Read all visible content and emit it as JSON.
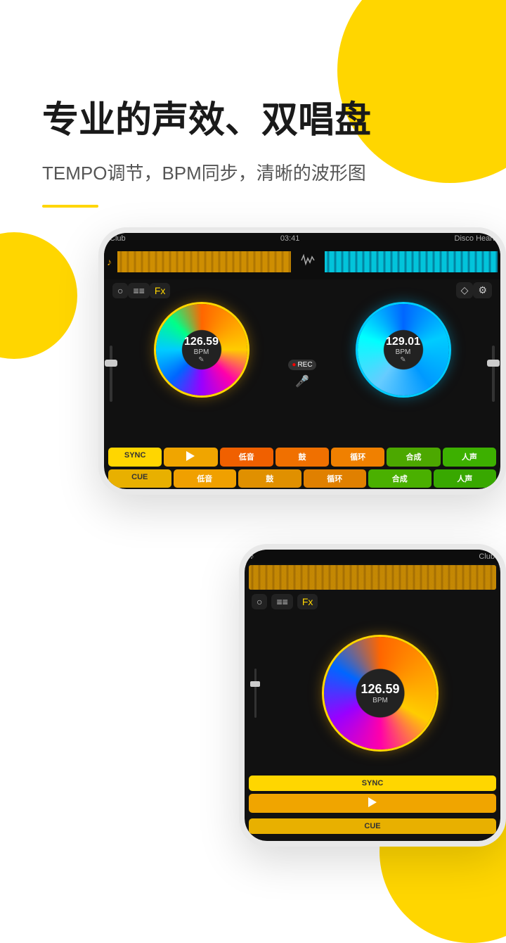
{
  "page": {
    "background": "#ffffff",
    "accent_color": "#FFD600"
  },
  "header": {
    "main_title": "专业的声效、双唱盘",
    "sub_title": "TEMPO调节，BPM同步，清晰的波形图"
  },
  "dj_ui": {
    "track_left": {
      "name": "Club",
      "time": "03:41",
      "bpm": "126.59",
      "bpm_label": "BPM"
    },
    "track_right": {
      "name": "Disco Heart",
      "bpm": "129.01",
      "bpm_label": "BPM"
    },
    "controls": {
      "left": [
        "○",
        "≡≡",
        "Fx"
      ],
      "right": [
        "◇",
        "⚙"
      ]
    },
    "buttons_row1": [
      "SYNC",
      "▶",
      "低音",
      "鼓",
      "循环",
      "合成",
      "人声"
    ],
    "buttons_row2": [
      "CUE",
      "低音",
      "鼓",
      "循环",
      "合成",
      "人声"
    ],
    "rec_label": "●REC",
    "mic_label": "🎤"
  },
  "mini_ui": {
    "track_name": "Club",
    "controls": [
      "○",
      "≡≡",
      "Fx"
    ],
    "buttons": [
      "SYNC",
      "▶",
      "CUE"
    ]
  }
}
